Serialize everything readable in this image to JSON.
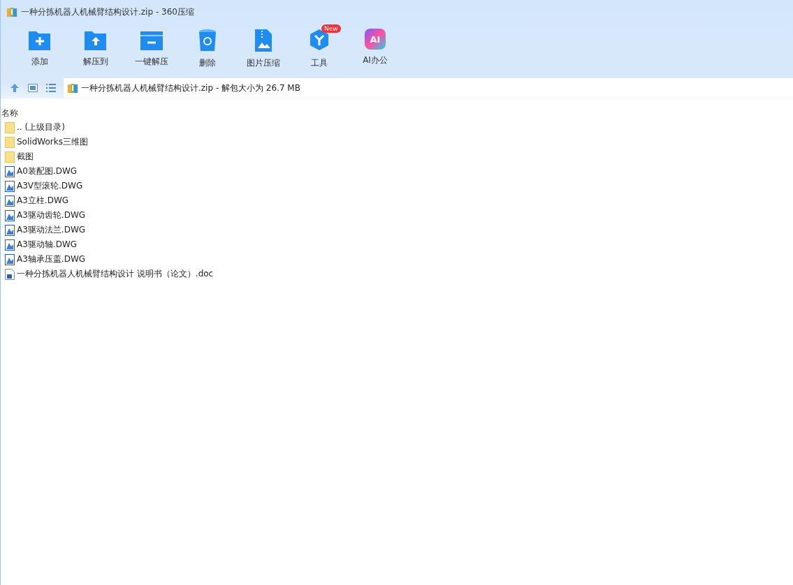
{
  "window": {
    "title": "一种分拣机器人机械臂结构设计.zip - 360压缩"
  },
  "toolbar": [
    {
      "kind": "add",
      "label": "添加"
    },
    {
      "kind": "extract",
      "label": "解压到"
    },
    {
      "kind": "oneclick",
      "label": "一键解压"
    },
    {
      "kind": "delete",
      "label": "删除"
    },
    {
      "kind": "image",
      "label": "图片压缩"
    },
    {
      "kind": "tools",
      "label": "工具",
      "badge": "New"
    },
    {
      "kind": "ai",
      "label": "AI办公",
      "icon_text": "AI"
    }
  ],
  "address": {
    "path": "一种分拣机器人机械臂结构设计.zip - 解包大小为 26.7 MB"
  },
  "list": {
    "columns": [
      "名称"
    ],
    "rows": [
      {
        "kind": "folder",
        "name": ".. (上级目录)"
      },
      {
        "kind": "folder",
        "name": "SolidWorks三维图"
      },
      {
        "kind": "folder",
        "name": "截图"
      },
      {
        "kind": "dwg",
        "name": "A0装配图.DWG"
      },
      {
        "kind": "dwg",
        "name": "A3V型滚轮.DWG"
      },
      {
        "kind": "dwg",
        "name": "A3立柱.DWG"
      },
      {
        "kind": "dwg",
        "name": "A3驱动齿轮.DWG"
      },
      {
        "kind": "dwg",
        "name": "A3驱动法兰.DWG"
      },
      {
        "kind": "dwg",
        "name": "A3驱动轴.DWG"
      },
      {
        "kind": "dwg",
        "name": "A3轴承压盖.DWG"
      },
      {
        "kind": "doc",
        "name": "一种分拣机器人机械臂结构设计 说明书（论文）.doc"
      }
    ]
  }
}
